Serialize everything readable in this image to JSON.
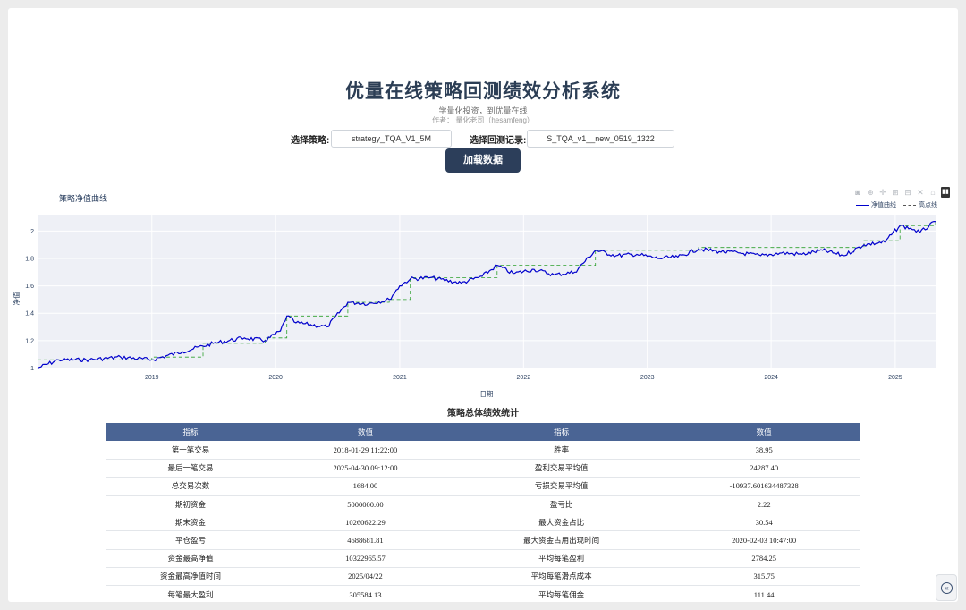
{
  "header": {
    "title": "优量在线策略回测绩效分析系统",
    "subtitle": "学量化投资，到优量在线",
    "author": "作者： 量化老司（hesamfeng）"
  },
  "controls": {
    "strategy_label": "选择策略:",
    "strategy_value": "strategy_TQA_V1_5M",
    "record_label": "选择回测记录:",
    "record_value": "S_TQA_v1__new_0519_1322",
    "load_button": "加载数据"
  },
  "modebar": {
    "icons": [
      "camera-icon",
      "zoom-icon",
      "pan-icon",
      "zoom-in-icon",
      "zoom-out-icon",
      "autoscale-icon",
      "home-icon",
      "plotly-logo-icon"
    ]
  },
  "chart_data": {
    "type": "line",
    "title": "策略净值曲线",
    "xlabel": "日期",
    "ylabel": "净值",
    "x_ticks": [
      "2019",
      "2020",
      "2021",
      "2022",
      "2023",
      "2024",
      "2025"
    ],
    "y_ticks": [
      1,
      1.2,
      1.4,
      1.6,
      1.8,
      2
    ],
    "xlim": [
      "2018-01-29",
      "2025-04-30"
    ],
    "ylim": [
      0.99,
      2.12
    ],
    "grid": true,
    "legend_position": "top-right",
    "series": [
      {
        "name": "净值曲线",
        "color": "#0000cc",
        "x": [
          "2018-01-29",
          "2018-04-01",
          "2018-07-01",
          "2018-10-01",
          "2019-01-01",
          "2019-04-01",
          "2019-07-01",
          "2019-10-01",
          "2019-12-01",
          "2020-01-15",
          "2020-02-03",
          "2020-03-01",
          "2020-06-01",
          "2020-08-01",
          "2020-10-01",
          "2020-12-01",
          "2021-01-01",
          "2021-02-01",
          "2021-04-01",
          "2021-07-01",
          "2021-09-01",
          "2021-10-15",
          "2021-12-01",
          "2022-02-01",
          "2022-04-01",
          "2022-06-01",
          "2022-08-01",
          "2022-10-01",
          "2022-12-01",
          "2023-02-01",
          "2023-04-01",
          "2023-06-01",
          "2023-08-01",
          "2023-10-01",
          "2023-12-01",
          "2024-02-01",
          "2024-04-01",
          "2024-06-01",
          "2024-08-01",
          "2024-10-01",
          "2024-12-01",
          "2025-01-15",
          "2025-02-15",
          "2025-03-15",
          "2025-04-30"
        ],
        "y": [
          1.0,
          1.06,
          1.06,
          1.08,
          1.06,
          1.12,
          1.18,
          1.22,
          1.2,
          1.27,
          1.38,
          1.33,
          1.3,
          1.48,
          1.47,
          1.5,
          1.6,
          1.65,
          1.66,
          1.62,
          1.67,
          1.75,
          1.69,
          1.72,
          1.68,
          1.7,
          1.86,
          1.82,
          1.83,
          1.8,
          1.81,
          1.87,
          1.85,
          1.84,
          1.82,
          1.84,
          1.83,
          1.86,
          1.82,
          1.9,
          1.92,
          2.04,
          2.02,
          1.99,
          2.07
        ]
      },
      {
        "name": "高点线",
        "color": "#2ca02c",
        "x": [
          "2018-01-29",
          "2019-01-01",
          "2019-06-01",
          "2019-12-01",
          "2020-02-03",
          "2020-08-01",
          "2020-12-01",
          "2021-02-01",
          "2021-10-15",
          "2022-08-01",
          "2023-06-01",
          "2024-10-01",
          "2025-01-15",
          "2025-04-30"
        ],
        "y": [
          1.06,
          1.08,
          1.18,
          1.22,
          1.38,
          1.48,
          1.5,
          1.66,
          1.75,
          1.86,
          1.88,
          1.93,
          2.04,
          2.07
        ]
      }
    ]
  },
  "stats": {
    "title": "策略总体绩效统计",
    "headers": [
      "指标",
      "数值",
      "指标",
      "数值"
    ],
    "rows": [
      [
        "第一笔交易",
        "2018-01-29 11:22:00",
        "胜率",
        "38.95"
      ],
      [
        "最后一笔交易",
        "2025-04-30 09:12:00",
        "盈利交易平均值",
        "24287.40"
      ],
      [
        "总交易次数",
        "1684.00",
        "亏损交易平均值",
        "-10937.601634487328"
      ],
      [
        "期初资金",
        "5000000.00",
        "盈亏比",
        "2.22"
      ],
      [
        "期末资金",
        "10260622.29",
        "最大资金占比",
        "30.54"
      ],
      [
        "平仓盈亏",
        "4688681.81",
        "最大资金占用出现时间",
        "2020-02-03 10:47:00"
      ],
      [
        "资金最高净值",
        "10322965.57",
        "平均每笔盈利",
        "2784.25"
      ],
      [
        "资金最高净值时间",
        "2025/04/22",
        "平均每笔滑点成本",
        "315.75"
      ],
      [
        "每笔最大盈利",
        "305584.13",
        "平均每笔佣金",
        "111.44"
      ]
    ]
  },
  "fab": {
    "icon": "collapse-icon",
    "glyph": "«"
  }
}
